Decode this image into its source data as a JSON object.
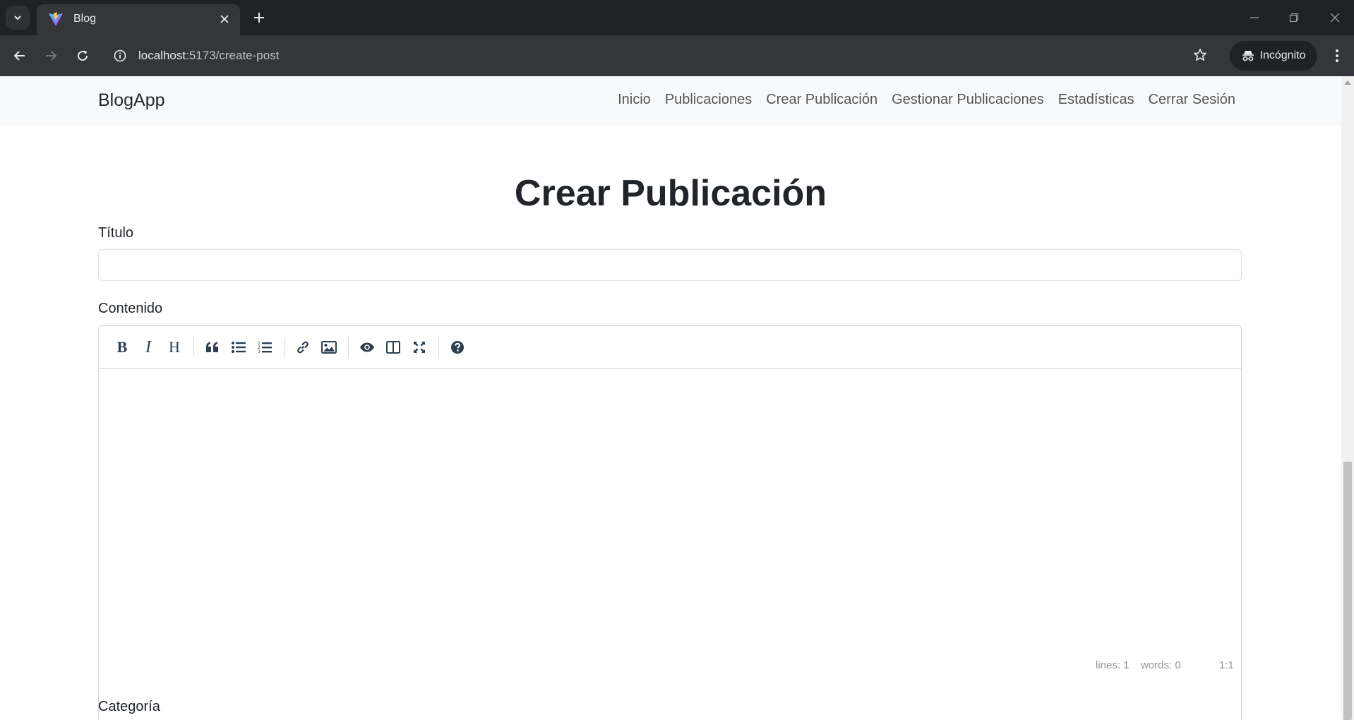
{
  "browser": {
    "tab_title": "Blog",
    "url_host": "localhost",
    "url_path": ":5173/create-post",
    "incognito_label": "Incógnito"
  },
  "navbar": {
    "brand": "BlogApp",
    "links": [
      "Inicio",
      "Publicaciones",
      "Crear Publicación",
      "Gestionar Publicaciones",
      "Estadísticas",
      "Cerrar Sesión"
    ]
  },
  "page": {
    "title": "Crear Publicación",
    "titulo_label": "Título",
    "titulo_value": "",
    "contenido_label": "Contenido",
    "categoria_label": "Categoría"
  },
  "editor": {
    "toolbar_icons": [
      "bold-icon",
      "italic-icon",
      "heading-icon",
      "quote-icon",
      "unordered-list-icon",
      "ordered-list-icon",
      "link-icon",
      "image-icon",
      "preview-icon",
      "side-by-side-icon",
      "fullscreen-icon",
      "guide-icon"
    ],
    "status": {
      "lines": "lines: 1",
      "words": "words: 0",
      "cursor": "1:1"
    }
  },
  "colors": {
    "chrome_dark": "#202124",
    "chrome_toolbar": "#35363a",
    "navbar_bg": "#f8f9fa",
    "text": "#212529",
    "nav_link": "#555555"
  }
}
